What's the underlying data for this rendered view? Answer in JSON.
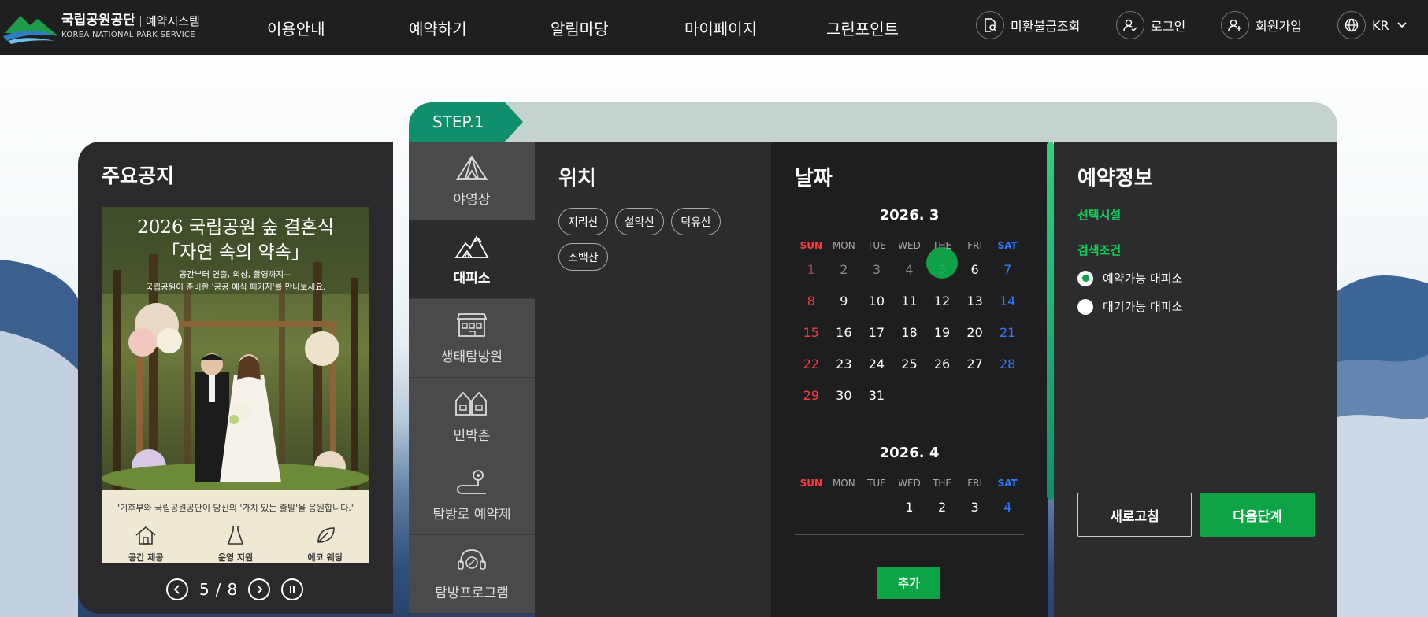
{
  "header": {
    "logo_kr": "국립공원공단",
    "logo_sub": "예약시스템",
    "logo_en": "KOREA NATIONAL PARK SERVICE",
    "nav": [
      "이용안내",
      "예약하기",
      "알림마당",
      "마이페이지",
      "그린포인트"
    ],
    "util": {
      "refund": "미환불금조회",
      "login": "로그인",
      "signup": "회원가입",
      "lang": "KR"
    }
  },
  "notice": {
    "title": "주요공지",
    "banner": {
      "title_line1": "2026 국립공원 숲 결혼식",
      "title_line2": "「자연 속의 약속」",
      "sub_line1": "공간부터 연출, 의상, 촬영까지—",
      "sub_line2": "국립공원이 준비한 '공공 예식 패키지'를 만나보세요.",
      "quote": "\"기후부와 국립공원공단이 당신의 '가치 있는 출발'을 응원합니다.\"",
      "features": [
        "공간 제공",
        "운영 지원",
        "에코 웨딩"
      ]
    },
    "pager": {
      "current": "5",
      "separator": "/",
      "total": "8"
    }
  },
  "step": {
    "label": "STEP.1"
  },
  "categories": [
    {
      "label": "야영장",
      "icon": "tent-icon",
      "active": false
    },
    {
      "label": "대피소",
      "icon": "shelter-icon",
      "active": true
    },
    {
      "label": "생태탐방원",
      "icon": "eco-center-icon",
      "active": false
    },
    {
      "label": "민박촌",
      "icon": "guesthouse-icon",
      "active": false
    },
    {
      "label": "탐방로 예약제",
      "icon": "trail-icon",
      "active": false
    },
    {
      "label": "탐방프로그램",
      "icon": "program-icon",
      "active": false
    }
  ],
  "location": {
    "title": "위치",
    "chips": [
      "지리산",
      "설악산",
      "덕유산",
      "소백산"
    ]
  },
  "date": {
    "title": "날짜",
    "dow": [
      "SUN",
      "MON",
      "TUE",
      "WED",
      "THE",
      "FRI",
      "SAT"
    ],
    "months": [
      {
        "title": "2026. 3",
        "weeks": [
          [
            "1",
            "2",
            "3",
            "4",
            "5",
            "6",
            "7"
          ],
          [
            "8",
            "9",
            "10",
            "11",
            "12",
            "13",
            "14"
          ],
          [
            "15",
            "16",
            "17",
            "18",
            "19",
            "20",
            "21"
          ],
          [
            "22",
            "23",
            "24",
            "25",
            "26",
            "27",
            "28"
          ],
          [
            "29",
            "30",
            "31",
            "",
            "",
            "",
            ""
          ]
        ],
        "past_until": 5,
        "today": "5"
      },
      {
        "title": "2026. 4",
        "weeks": [
          [
            "",
            "",
            "",
            "1",
            "2",
            "3",
            "4"
          ]
        ],
        "past_until": 0,
        "today": ""
      }
    ],
    "add_label": "추가"
  },
  "info": {
    "title": "예약정보",
    "facility_label": "선택시설",
    "condition_label": "검색조건",
    "options": [
      {
        "label": "예약가능 대피소",
        "selected": true
      },
      {
        "label": "대기가능 대피소",
        "selected": false
      }
    ],
    "refresh_label": "새로고침",
    "next_label": "다음단계"
  },
  "colors": {
    "accent": "#0da446",
    "step": "#0f8f6c",
    "header": "#1e1f21"
  }
}
